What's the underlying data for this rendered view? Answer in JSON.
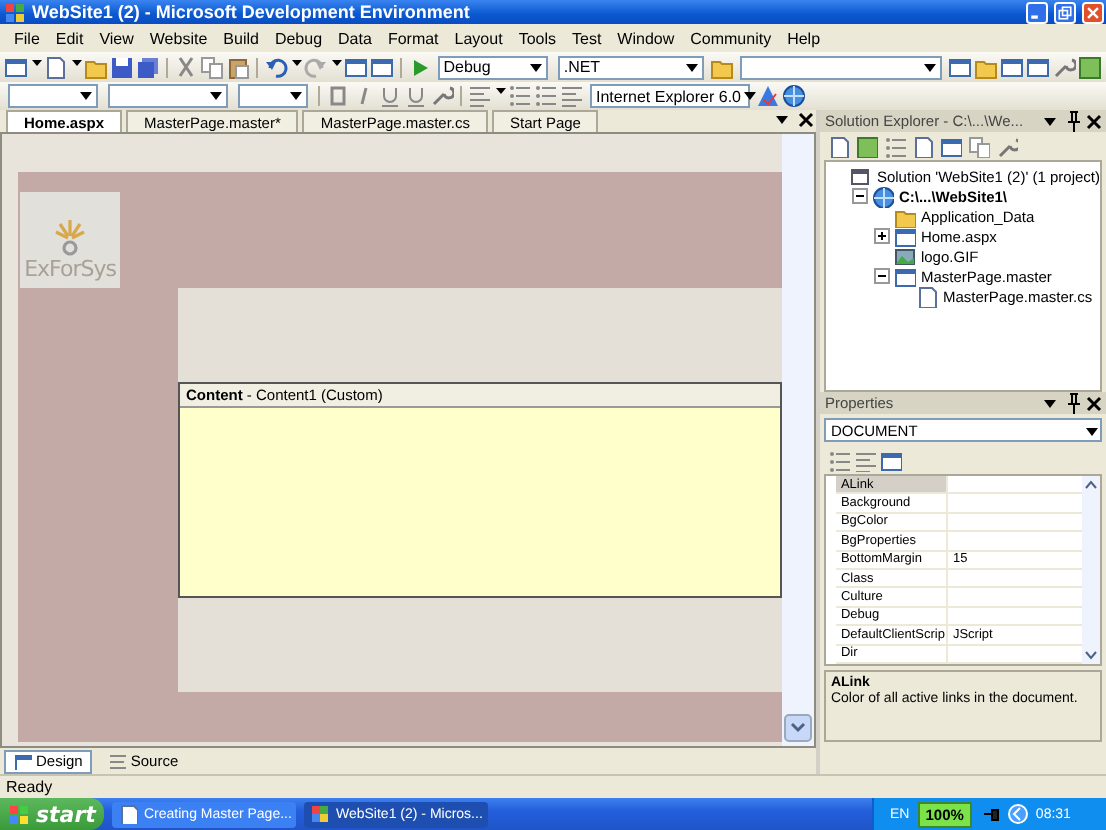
{
  "window": {
    "title": "WebSite1 (2) - Microsoft Development Environment"
  },
  "menu": [
    "File",
    "Edit",
    "View",
    "Website",
    "Build",
    "Debug",
    "Data",
    "Format",
    "Layout",
    "Tools",
    "Test",
    "Window",
    "Community",
    "Help"
  ],
  "toolbar": {
    "configuration": "Debug",
    "platform": ".NET",
    "target_browser": "Internet Explorer 6.0"
  },
  "document_tabs": [
    {
      "label": "Home.aspx",
      "selected": true
    },
    {
      "label": "MasterPage.master*",
      "selected": false
    },
    {
      "label": "MasterPage.master.cs",
      "selected": false
    },
    {
      "label": "Start Page",
      "selected": false
    }
  ],
  "designer": {
    "logo_text": "ExForSys",
    "content_header": "**Content** - Content1 (Custom)"
  },
  "view_tabs": [
    {
      "label": "Design",
      "selected": true
    },
    {
      "label": "Source",
      "selected": false
    }
  ],
  "solution_explorer": {
    "title": "Solution Explorer - C:\\...\\We...",
    "tree": [
      {
        "label": "Solution 'WebSite1 (2)' (1 project)",
        "kind": "solution",
        "children": [
          {
            "label": "C:\\...\\WebSite1\\",
            "kind": "website",
            "expanded": true,
            "children": [
              {
                "label": "Application_Data",
                "kind": "folder"
              },
              {
                "label": "Home.aspx",
                "kind": "page",
                "expanded": false
              },
              {
                "label": "logo.GIF",
                "kind": "image"
              },
              {
                "label": "MasterPage.master",
                "kind": "page",
                "expanded": true,
                "children": [
                  {
                    "label": "MasterPage.master.cs",
                    "kind": "code"
                  }
                ]
              }
            ]
          }
        ]
      }
    ]
  },
  "properties": {
    "title": "Properties",
    "object": "DOCUMENT",
    "rows": [
      {
        "name": "ALink",
        "selected": true
      },
      {
        "name": "Background",
        "selected": false
      },
      {
        "name": "BgColor",
        "selected": false
      },
      {
        "name": "BgProperties",
        "selected": false
      },
      {
        "name": "BottomMargin",
        "value": "15",
        "selected": false
      },
      {
        "name": "Class",
        "selected": false
      },
      {
        "name": "Culture",
        "selected": false
      },
      {
        "name": "Debug",
        "selected": false
      },
      {
        "name": "DefaultClientScrip",
        "value": "JScript",
        "selected": false
      },
      {
        "name": "Dir",
        "selected": false
      }
    ],
    "description": {
      "title": "ALink",
      "text": "Color of all active links in the document."
    }
  },
  "status_bar": "Ready",
  "taskbar": {
    "start": "start",
    "tasks": [
      {
        "label": "Creating Master Page...",
        "selected": false
      },
      {
        "label": "WebSite1 (2) - Micros...",
        "selected": true
      }
    ],
    "tray": {
      "language": "EN",
      "battery": "100%",
      "clock": "08:31"
    }
  }
}
